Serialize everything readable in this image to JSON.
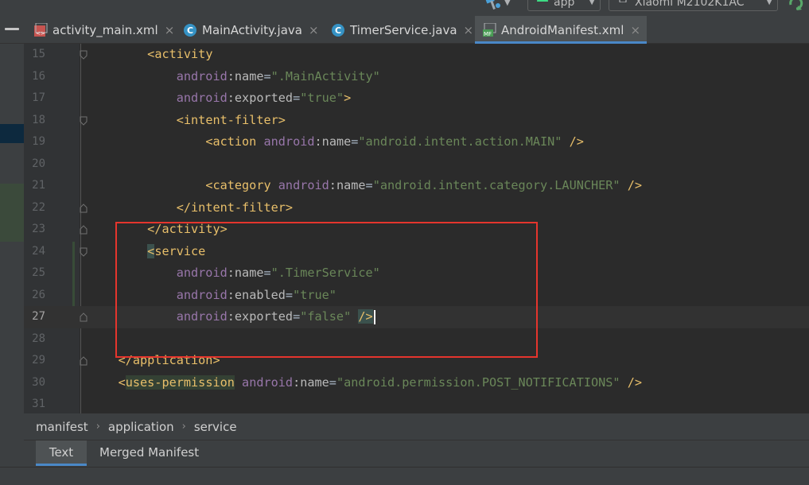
{
  "toolbar": {
    "run_config": "app",
    "device": "Xiaomi M2102K1AC",
    "icons": [
      "build-hammer-icon",
      "android-icon",
      "device-icon",
      "sync-icon"
    ]
  },
  "tabs": [
    {
      "label": "activity_main.xml",
      "icon": "xml-layout-file-icon",
      "active": false
    },
    {
      "label": "MainActivity.java",
      "icon": "java-class-icon",
      "active": false
    },
    {
      "label": "TimerService.java",
      "icon": "java-class-icon",
      "active": false
    },
    {
      "label": "AndroidManifest.xml",
      "icon": "manifest-file-icon",
      "active": true
    }
  ],
  "tab_close_glyph": "×",
  "editor": {
    "lines": [
      {
        "num": "15"
      },
      {
        "num": "16"
      },
      {
        "num": "17"
      },
      {
        "num": "18"
      },
      {
        "num": "19"
      },
      {
        "num": "20"
      },
      {
        "num": "21"
      },
      {
        "num": "22"
      },
      {
        "num": "23"
      },
      {
        "num": "24"
      },
      {
        "num": "25"
      },
      {
        "num": "26"
      },
      {
        "num": "27"
      },
      {
        "num": "28"
      },
      {
        "num": "29"
      },
      {
        "num": "30"
      },
      {
        "num": "31"
      }
    ],
    "current_line": "27",
    "tokens": {
      "lt": "<",
      "gt": ">",
      "slash_gt": "/>",
      "lt_slash": "</",
      "eq": "=",
      "colon": ":",
      "activity": "activity",
      "android": "android",
      "name": "name",
      "exported": "exported",
      "enabled": "enabled",
      "intent_filter": "intent-filter",
      "action": "action",
      "category": "category",
      "service": "service",
      "application": "application",
      "uses_permission": "uses-permission",
      "v_main_activity": "\".MainActivity\"",
      "v_true": "\"true\"",
      "v_false": "\"false\"",
      "v_action_main": "\"android.intent.action.MAIN\"",
      "v_category_launcher": "\"android.intent.category.LAUNCHER\"",
      "v_timer_service": "\".TimerService\"",
      "v_post_notifications": "\"android.permission.POST_NOTIFICATIONS\""
    }
  },
  "breadcrumb": {
    "items": [
      "manifest",
      "application",
      "service"
    ],
    "separator": "›"
  },
  "bottom_tabs": [
    {
      "label": "Text",
      "active": true
    },
    {
      "label": "Merged Manifest",
      "active": false
    }
  ],
  "colors": {
    "tag": "#e8bf6a",
    "attr_namespace": "#9876aa",
    "attr_value": "#6a8759",
    "highlight_box": "#e5352d",
    "accent": "#4a88c7"
  }
}
